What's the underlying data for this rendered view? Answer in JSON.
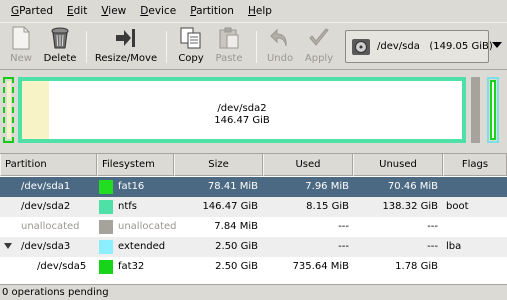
{
  "menu": [
    {
      "first": "G",
      "rest": "Parted"
    },
    {
      "first": "E",
      "rest": "dit"
    },
    {
      "first": "V",
      "rest": "iew"
    },
    {
      "first": "D",
      "rest": "evice"
    },
    {
      "first": "P",
      "rest": "artition"
    },
    {
      "first": "H",
      "rest": "elp"
    }
  ],
  "toolbar": {
    "new": "New",
    "delete": "Delete",
    "resize_move": "Resize/Move",
    "copy": "Copy",
    "paste": "Paste",
    "undo": "Undo",
    "apply": "Apply"
  },
  "device": {
    "name": "/dev/sda",
    "size": "(149.05 GiB)"
  },
  "diskmap": {
    "main_label": "/dev/sda2",
    "main_size": "146.47 GiB"
  },
  "table": {
    "headers": [
      "Partition",
      "Filesystem",
      "Size",
      "Used",
      "Unused",
      "Flags"
    ],
    "rows": [
      {
        "partition": "/dev/sda1",
        "fs": "fat16",
        "size": "78.41 MiB",
        "used": "7.96 MiB",
        "unused": "70.46 MiB",
        "flags": "",
        "color": "#22dd22"
      },
      {
        "partition": "/dev/sda2",
        "fs": "ntfs",
        "size": "146.47 GiB",
        "used": "8.15 GiB",
        "unused": "138.32 GiB",
        "flags": "boot",
        "color": "#4fe0a8"
      },
      {
        "partition": "unallocated",
        "fs": "unallocated",
        "size": "7.84 MiB",
        "used": "---",
        "unused": "---",
        "flags": "",
        "color": "#a6a39c"
      },
      {
        "partition": "/dev/sda3",
        "fs": "extended",
        "size": "2.50 GiB",
        "used": "---",
        "unused": "---",
        "flags": "lba",
        "color": "#8cefff"
      },
      {
        "partition": "/dev/sda5",
        "fs": "fat32",
        "size": "2.50 GiB",
        "used": "735.64 MiB",
        "unused": "1.78 GiB",
        "flags": "",
        "color": "#17d41b"
      }
    ]
  },
  "status": "0 operations pending"
}
